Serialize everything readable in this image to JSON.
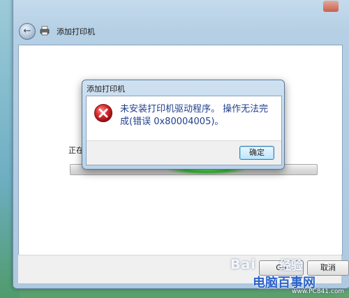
{
  "window": {
    "title": "添加打印机",
    "status_text": "正在",
    "next_label": "Gu",
    "cancel_label": "取消"
  },
  "dialog": {
    "title": "添加打印机",
    "message": "未安装打印机驱动程序。 操作无法完成(错误 0x80004005)。",
    "ok_label": "确定"
  },
  "icons": {
    "back": "back-arrow-icon",
    "printer": "printer-icon",
    "error": "error-icon"
  },
  "watermark": {
    "baidu": "Bai",
    "jingyan": "经验",
    "site": "电脑百事网",
    "url": "www.PC841.com"
  },
  "colors": {
    "message_text": "#1f3f8c",
    "error_red": "#d8262b",
    "progress_green": "#3fcf3f"
  }
}
